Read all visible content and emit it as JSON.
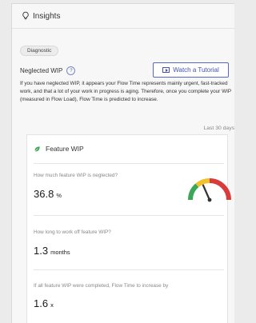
{
  "header": {
    "title": "Insights",
    "icon": "lightbulb-icon"
  },
  "tag": "Diagnostic",
  "section": {
    "title": "Neglected WIP",
    "help_icon": "question-circle-icon",
    "tutorial_button": "Watch a Tutorial",
    "description": "If you have neglected WIP, it appears your Flow Time represents mainly urgent, fast-tracked work, and that a lot of your work in progress is aging. Therefore, once you complete your WIP (measured in Flow Load), Flow Time is predicted to increase.",
    "period": "Last 30 days"
  },
  "card": {
    "title": "Feature WIP",
    "icon": "leaf-icon",
    "metrics": [
      {
        "question": "How much feature WIP is neglected?",
        "value": "36.8",
        "unit": "%",
        "gauge_fraction": 0.368
      },
      {
        "question": "How long to work off feature WIP?",
        "value": "1.3",
        "unit": "months"
      },
      {
        "question": "If all feature WIP were completed, Flow Time to increase by",
        "value": "1.6",
        "unit": "x"
      }
    ]
  },
  "colors": {
    "accent": "#4452b3",
    "gauge_green": "#3aa757",
    "gauge_yellow": "#f2c12e",
    "gauge_red": "#d93a3a",
    "needle": "#333333"
  }
}
